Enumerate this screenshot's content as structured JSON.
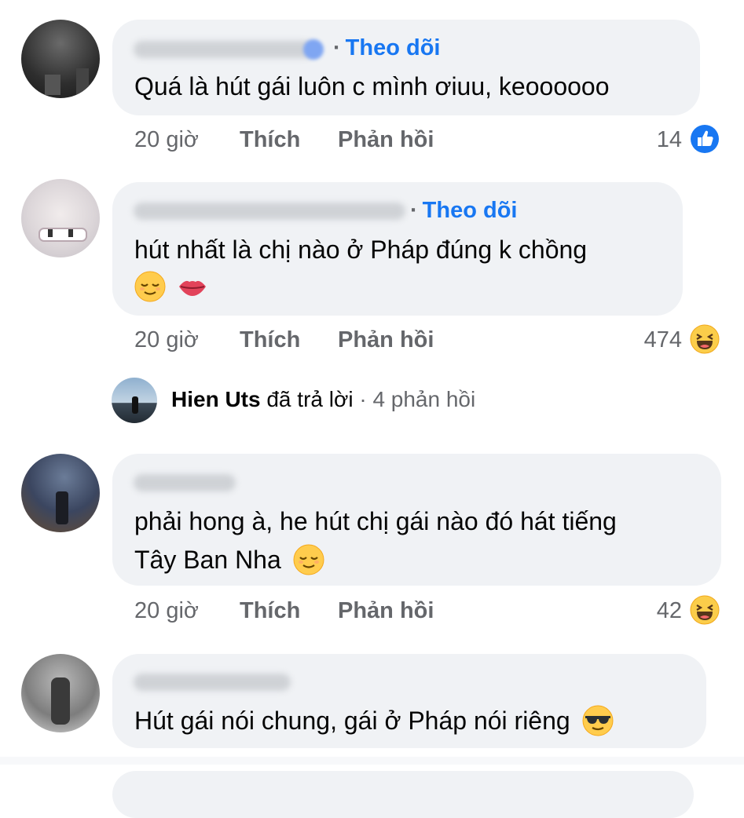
{
  "comments": [
    {
      "follow": "Theo dõi",
      "text_lines": [
        "Quá là hút gái luôn c mình ơiuu, keoooooo"
      ],
      "time": "20 giờ",
      "like": "Thích",
      "reply": "Phản hồi",
      "reaction_count": "14",
      "reaction_icon": "like-icon"
    },
    {
      "follow": "Theo dõi",
      "text_lines": [
        "hút nhất là chị nào ở Pháp đúng k chồng"
      ],
      "emojis": [
        "relieved-face-icon",
        "lips-icon"
      ],
      "time": "20 giờ",
      "like": "Thích",
      "reply": "Phản hồi",
      "reaction_count": "474",
      "reaction_icon": "haha-icon"
    },
    {
      "text_lines": [
        "phải hong à, he hút chị gái nào đó hát tiếng",
        "Tây Ban Nha"
      ],
      "emojis": [
        "relieved-face-icon"
      ],
      "time": "20 giờ",
      "like": "Thích",
      "reply": "Phản hồi",
      "reaction_count": "42",
      "reaction_icon": "haha-icon"
    },
    {
      "text_lines": [
        "Hút gái nói chung, gái ở Pháp nói riêng"
      ],
      "emojis": [
        "sunglasses-face-icon"
      ]
    }
  ],
  "reply_summary": {
    "name": "Hien Uts",
    "action": "đã trả lời",
    "separator": "·",
    "count": "4 phản hồi"
  },
  "colors": {
    "bubble": "#f0f2f5",
    "link": "#1877f2",
    "muted": "#65676b"
  }
}
